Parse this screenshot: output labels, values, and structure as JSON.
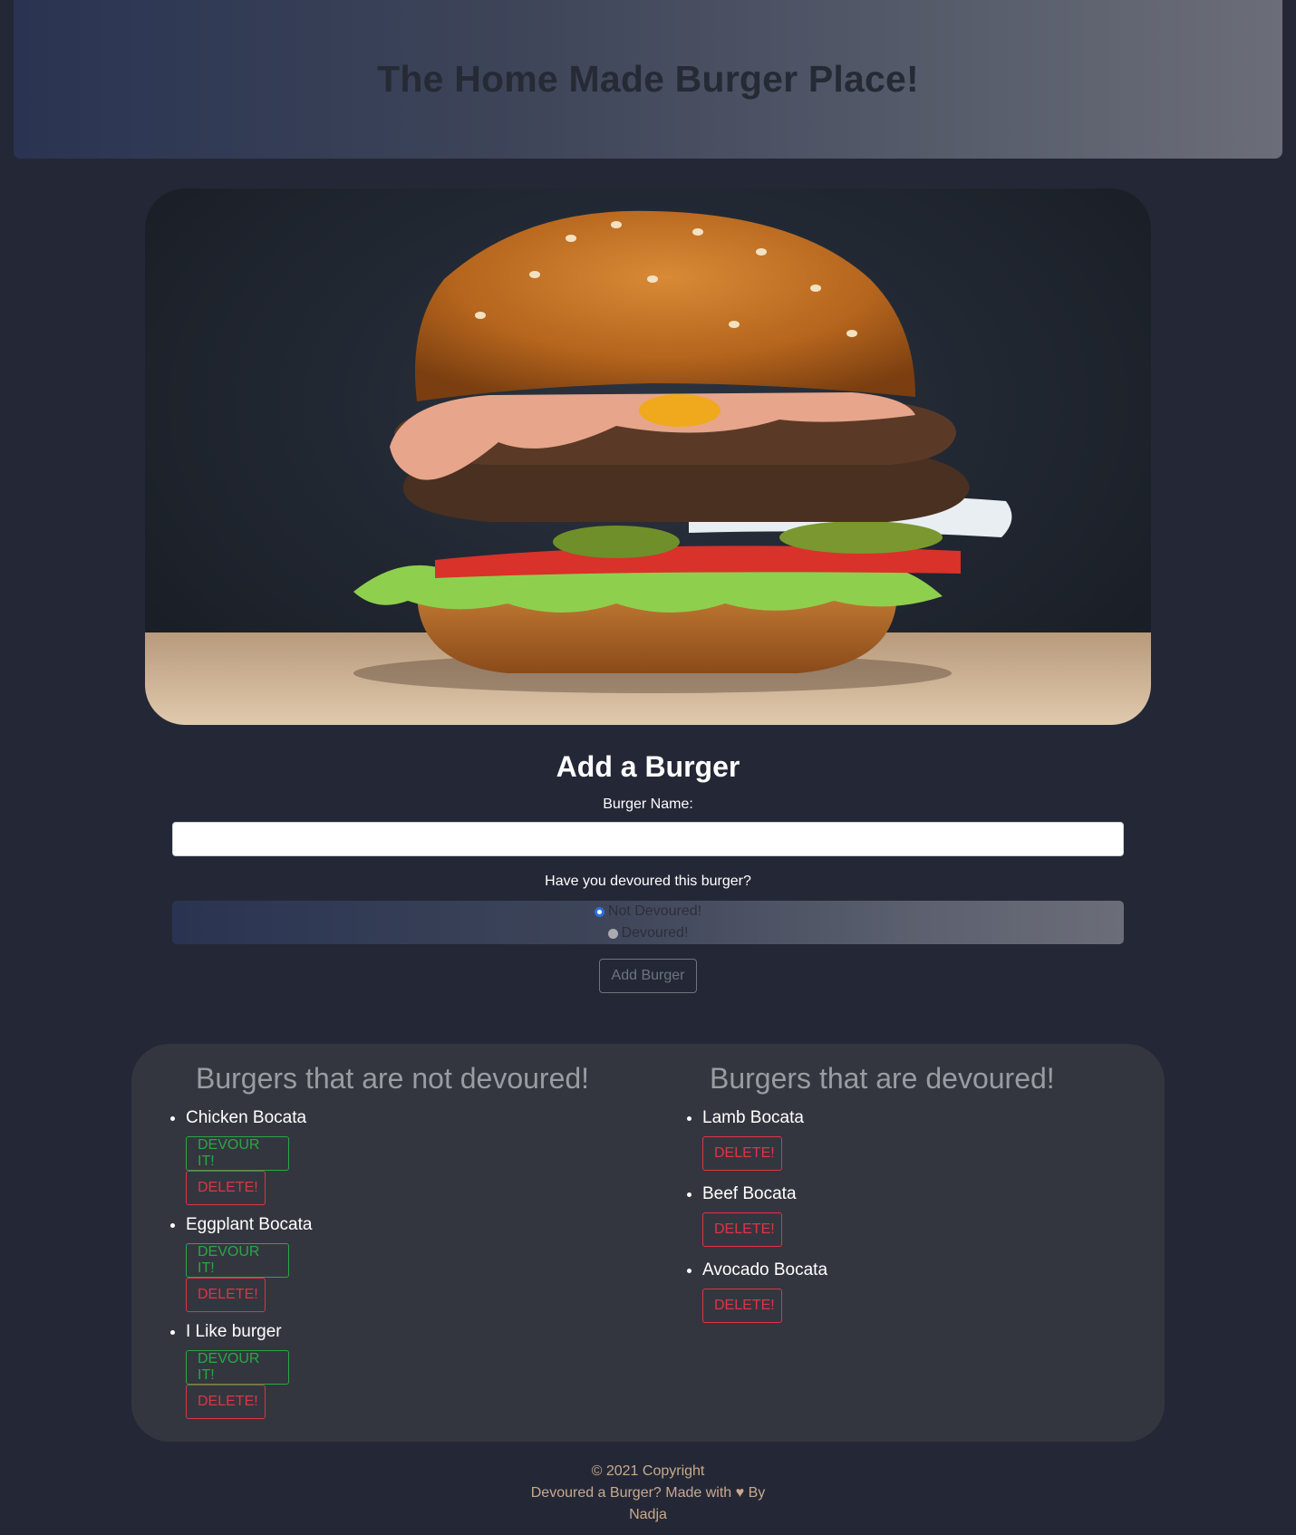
{
  "header": {
    "title": "The Home Made Burger Place!"
  },
  "hero": {
    "image": "burger-photo"
  },
  "form": {
    "title": "Add a Burger",
    "name_label": "Burger Name:",
    "name_value": "",
    "question": "Have you devoured this burger?",
    "options": [
      "Not Devoured!",
      "Devoured!"
    ],
    "selected": "Not Devoured!",
    "submit_label": "Add Burger"
  },
  "not_devoured": {
    "heading": "Burgers that are not devoured!",
    "items": [
      {
        "name": "Chicken Bocata",
        "devour_label": "DEVOUR IT!",
        "delete_label": "DELETE!"
      },
      {
        "name": "Eggplant Bocata",
        "devour_label": "DEVOUR IT!",
        "delete_label": "DELETE!"
      },
      {
        "name": "I Like burger",
        "devour_label": "DEVOUR IT!",
        "delete_label": "DELETE!"
      }
    ]
  },
  "devoured": {
    "heading": "Burgers that are devoured!",
    "items": [
      {
        "name": "Lamb Bocata",
        "delete_label": "DELETE!"
      },
      {
        "name": "Beef Bocata",
        "delete_label": "DELETE!"
      },
      {
        "name": "Avocado Bocata",
        "delete_label": "DELETE!"
      }
    ]
  },
  "footer": {
    "copyright": "© 2021 Copyright",
    "made_with_prefix": "Devoured a Burger? Made with",
    "heart_icon": "heart-icon",
    "made_with_suffix": "By",
    "author": "Nadja"
  },
  "colors": {
    "background": "#242836",
    "success": "#28a745",
    "danger": "#dc3545",
    "footer_text": "#c9a98e"
  }
}
